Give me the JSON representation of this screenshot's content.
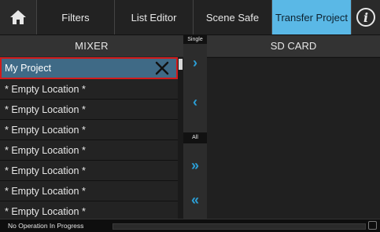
{
  "header": {
    "tabs": [
      {
        "label": "Filters"
      },
      {
        "label": "List Editor"
      },
      {
        "label": "Scene Safe"
      },
      {
        "label": "Transfer Project",
        "active": true
      }
    ],
    "info_symbol": "i"
  },
  "mixer": {
    "title": "MIXER",
    "items": [
      {
        "label": "My Project",
        "selected": true
      },
      {
        "label": "* Empty Location *"
      },
      {
        "label": "* Empty Location *"
      },
      {
        "label": "* Empty Location *"
      },
      {
        "label": "* Empty Location *"
      },
      {
        "label": "* Empty Location *"
      },
      {
        "label": "* Empty Location *"
      },
      {
        "label": "* Empty Location *"
      }
    ]
  },
  "transfer": {
    "single_label": "Single",
    "all_label": "All",
    "single_right_glyph": "›",
    "single_left_glyph": "‹",
    "all_right_glyph": "»",
    "all_left_glyph": "«"
  },
  "sdcard": {
    "title": "SD CARD"
  },
  "status": {
    "text": "No Operation In Progress",
    "progress": 0
  },
  "colors": {
    "accent": "#5ab8e6",
    "arrow": "#2b9fd6",
    "selection_border": "#d11b1b",
    "selection_fill": "#3f6a86"
  },
  "icons": [
    "home-icon",
    "info-icon",
    "close-icon",
    "resize-icon"
  ]
}
